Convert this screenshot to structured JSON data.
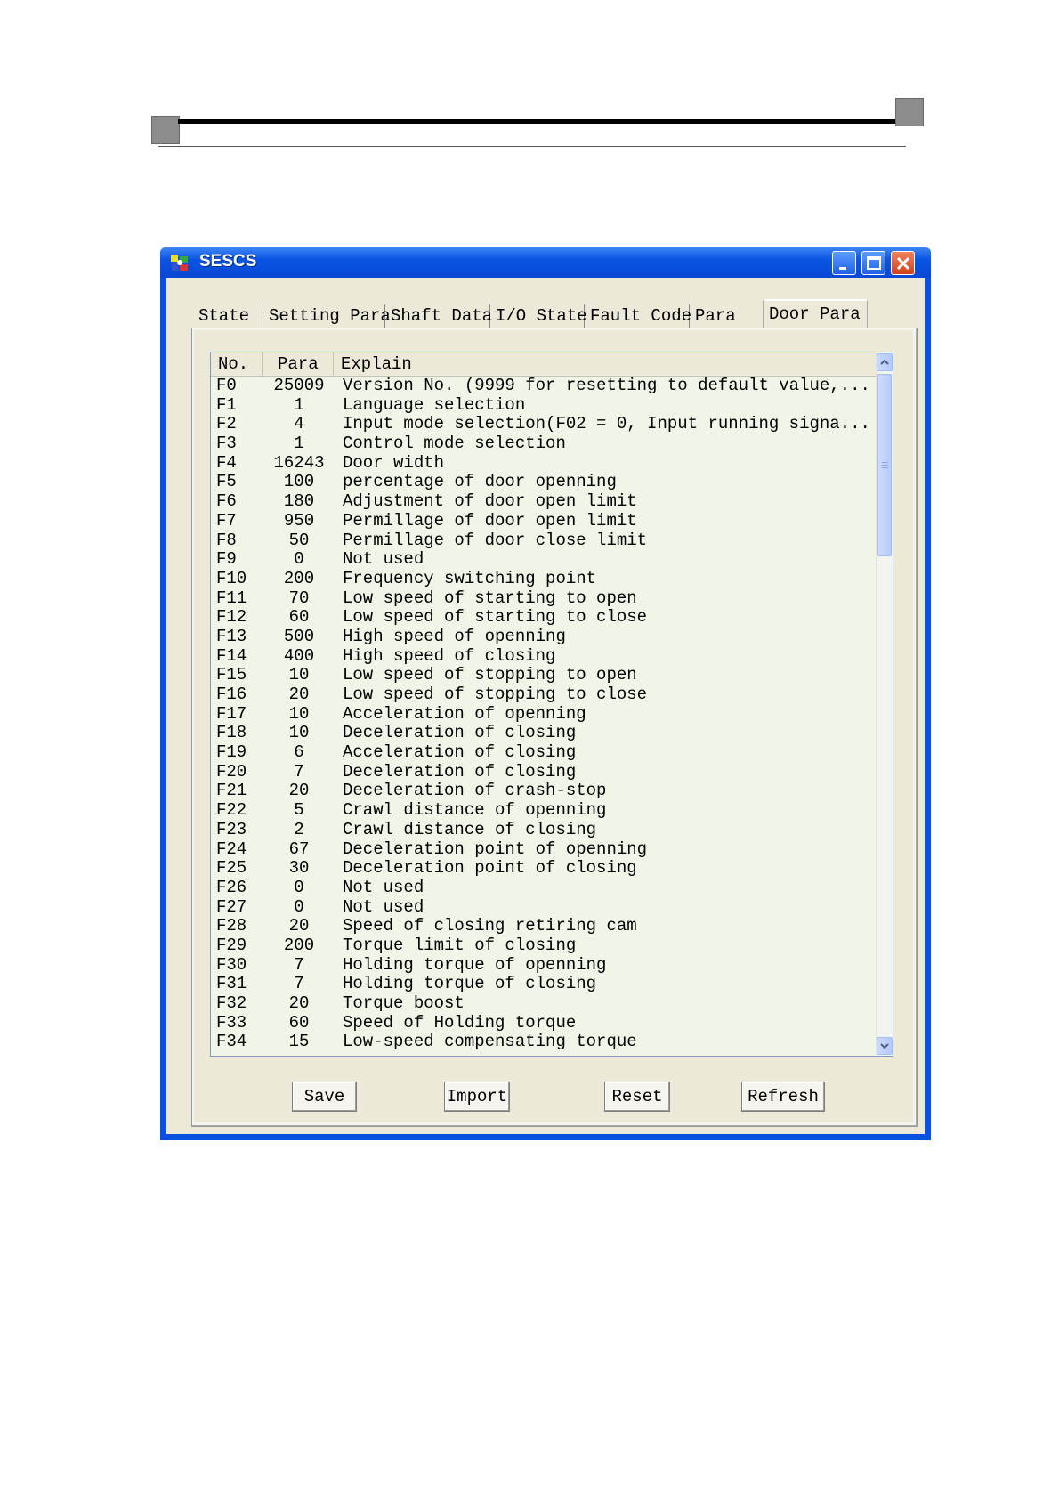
{
  "window": {
    "title": "SESCS",
    "app_icon": "sescs-app-icon"
  },
  "tabs": [
    {
      "label": "State"
    },
    {
      "label": "Setting Para"
    },
    {
      "label": "Shaft Data"
    },
    {
      "label": "I/O State"
    },
    {
      "label": "Fault Code"
    },
    {
      "label": "Para"
    },
    {
      "label": "Door Para",
      "active": true
    }
  ],
  "list": {
    "headers": {
      "no": "No.",
      "para": "Para",
      "explain": "Explain"
    },
    "rows": [
      {
        "no": "F0",
        "para": "25009",
        "explain": "Version No. (9999 for resetting to default value,..."
      },
      {
        "no": "F1",
        "para": "1",
        "explain": "Language  selection"
      },
      {
        "no": "F2",
        "para": "4",
        "explain": "Input mode selection(F02 = 0, Input running signa..."
      },
      {
        "no": "F3",
        "para": "1",
        "explain": "Control mode selection"
      },
      {
        "no": "F4",
        "para": "16243",
        "explain": "Door width"
      },
      {
        "no": "F5",
        "para": "100",
        "explain": "percentage of door openning"
      },
      {
        "no": "F6",
        "para": "180",
        "explain": "Adjustment of door open limit"
      },
      {
        "no": "F7",
        "para": "950",
        "explain": "Permillage of door open limit"
      },
      {
        "no": "F8",
        "para": "50",
        "explain": "Permillage of door close limit"
      },
      {
        "no": "F9",
        "para": "0",
        "explain": "Not used"
      },
      {
        "no": "F10",
        "para": "200",
        "explain": "Frequency switching point"
      },
      {
        "no": "F11",
        "para": "70",
        "explain": "Low speed of starting to open"
      },
      {
        "no": "F12",
        "para": "60",
        "explain": "Low speed of starting to close"
      },
      {
        "no": "F13",
        "para": "500",
        "explain": "High speed of openning"
      },
      {
        "no": "F14",
        "para": "400",
        "explain": "High speed of closing"
      },
      {
        "no": "F15",
        "para": "10",
        "explain": "Low speed of stopping to open"
      },
      {
        "no": "F16",
        "para": "20",
        "explain": "Low speed of stopping to close"
      },
      {
        "no": "F17",
        "para": "10",
        "explain": "Acceleration of openning"
      },
      {
        "no": "F18",
        "para": "10",
        "explain": "Deceleration of closing"
      },
      {
        "no": "F19",
        "para": "6",
        "explain": "Acceleration of closing"
      },
      {
        "no": "F20",
        "para": "7",
        "explain": "Deceleration of closing"
      },
      {
        "no": "F21",
        "para": "20",
        "explain": "Deceleration of crash-stop"
      },
      {
        "no": "F22",
        "para": "5",
        "explain": "Crawl distance of openning"
      },
      {
        "no": "F23",
        "para": "2",
        "explain": "Crawl distance of closing"
      },
      {
        "no": "F24",
        "para": "67",
        "explain": "Deceleration point of openning"
      },
      {
        "no": "F25",
        "para": "30",
        "explain": "Deceleration point of closing"
      },
      {
        "no": "F26",
        "para": "0",
        "explain": "Not used"
      },
      {
        "no": "F27",
        "para": "0",
        "explain": "Not used"
      },
      {
        "no": "F28",
        "para": "20",
        "explain": "Speed of closing retiring cam"
      },
      {
        "no": "F29",
        "para": "200",
        "explain": "Torque limit of closing"
      },
      {
        "no": "F30",
        "para": "7",
        "explain": "Holding torque of openning"
      },
      {
        "no": "F31",
        "para": "7",
        "explain": "Holding torque of closing"
      },
      {
        "no": "F32",
        "para": "20",
        "explain": "Torque boost"
      },
      {
        "no": "F33",
        "para": "60",
        "explain": "Speed of Holding torque"
      },
      {
        "no": "F34",
        "para": "15",
        "explain": "Low-speed compensating torque"
      }
    ]
  },
  "buttons": {
    "save": "Save",
    "import": "Import",
    "reset": "Reset",
    "refresh": "Refresh"
  },
  "colors": {
    "titlebar": "#0a54e4",
    "list_bg": "#f0f5e8",
    "face": "#ece9d8",
    "close": "#d1401a"
  }
}
